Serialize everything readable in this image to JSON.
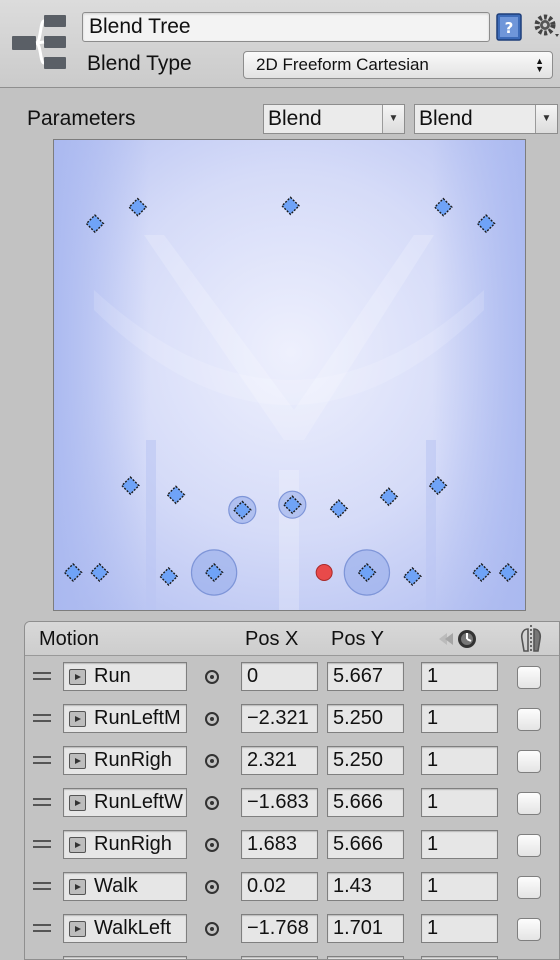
{
  "header": {
    "name": "Blend Tree",
    "blend_type_label": "Blend Type",
    "blend_type_value": "2D Freeform Cartesian",
    "icons": [
      "blend-tree-icon",
      "help-book-icon",
      "gear-icon"
    ]
  },
  "parameters": {
    "label": "Parameters",
    "x_param": "Blend",
    "y_param": "Blend"
  },
  "graph": {
    "colors": {
      "point": "#6fa3f7",
      "current": "#e84a4a",
      "background": "#c5cdf6"
    },
    "current_position": [
      0.37,
      0.4
    ],
    "points": [
      {
        "x": -2.15,
        "y": 5.7
      },
      {
        "x": -1.68,
        "y": 5.95
      },
      {
        "x": 0.0,
        "y": 5.97
      },
      {
        "x": 1.68,
        "y": 5.95
      },
      {
        "x": 2.15,
        "y": 5.7
      },
      {
        "x": -1.76,
        "y": 1.72
      },
      {
        "x": -1.26,
        "y": 1.58
      },
      {
        "x": -0.53,
        "y": 1.35
      },
      {
        "x": 0.02,
        "y": 1.43
      },
      {
        "x": 0.53,
        "y": 1.37
      },
      {
        "x": 1.08,
        "y": 1.55
      },
      {
        "x": 1.62,
        "y": 1.72
      },
      {
        "x": -2.39,
        "y": 0.4
      },
      {
        "x": -2.1,
        "y": 0.4
      },
      {
        "x": -1.34,
        "y": 0.34
      },
      {
        "x": -0.84,
        "y": 0.4
      },
      {
        "x": 0.84,
        "y": 0.4
      },
      {
        "x": 1.34,
        "y": 0.34
      },
      {
        "x": 2.1,
        "y": 0.4
      },
      {
        "x": 2.39,
        "y": 0.4
      }
    ],
    "weighted_points": [
      {
        "index": 7,
        "weight": 0.25
      },
      {
        "index": 8,
        "weight": 0.25
      },
      {
        "index": 15,
        "weight": 0.9
      },
      {
        "index": 16,
        "weight": 0.9
      }
    ]
  },
  "table": {
    "headers": {
      "motion": "Motion",
      "pos_x": "Pos X",
      "pos_y": "Pos Y"
    },
    "header_icons": [
      "speed-clock-icon",
      "mirror-icon"
    ],
    "rows": [
      {
        "clip": "Run",
        "pos_x": "0",
        "pos_y": "5.667",
        "speed": "1",
        "mirror": false
      },
      {
        "clip": "RunLeftM",
        "pos_x": "−2.321",
        "pos_y": "5.250",
        "speed": "1",
        "mirror": false
      },
      {
        "clip": "RunRigh",
        "pos_x": "2.321",
        "pos_y": "5.250",
        "speed": "1",
        "mirror": false
      },
      {
        "clip": "RunLeftW",
        "pos_x": "−1.683",
        "pos_y": "5.666",
        "speed": "1",
        "mirror": false
      },
      {
        "clip": "RunRigh",
        "pos_x": "1.683",
        "pos_y": "5.666",
        "speed": "1",
        "mirror": false
      },
      {
        "clip": "Walk",
        "pos_x": "0.02",
        "pos_y": "1.43",
        "speed": "1",
        "mirror": false
      },
      {
        "clip": "WalkLeft",
        "pos_x": "−1.768",
        "pos_y": "1.701",
        "speed": "1",
        "mirror": false
      },
      {
        "clip": "",
        "pos_x": "",
        "pos_y": "",
        "speed": "",
        "mirror": false
      }
    ]
  }
}
